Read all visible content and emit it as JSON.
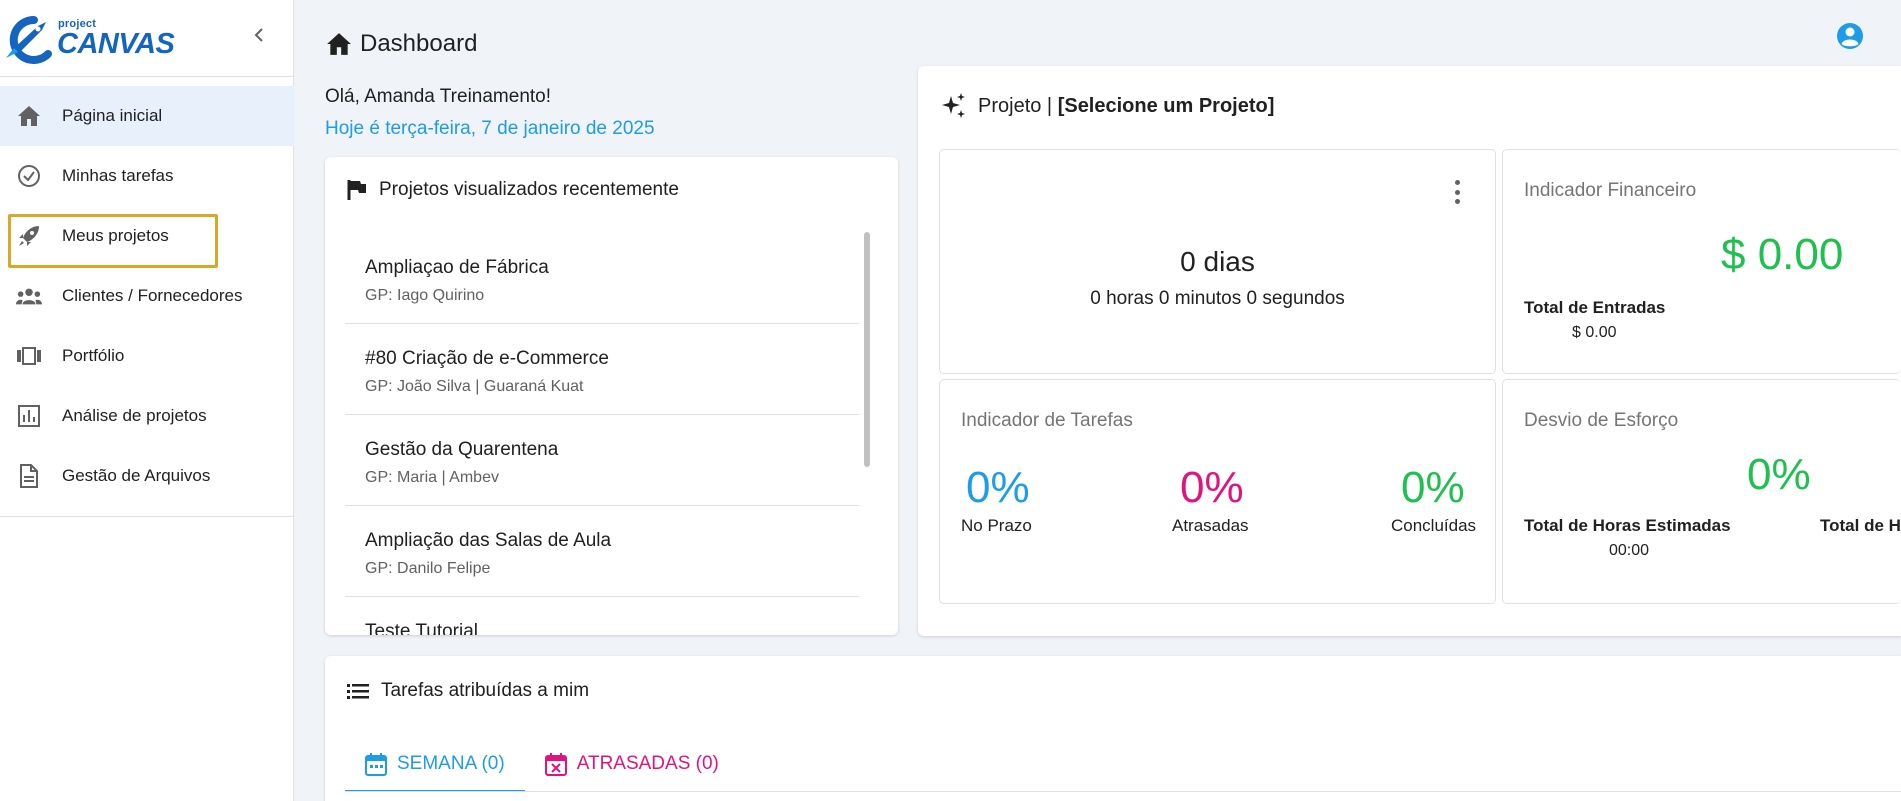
{
  "app": {
    "logo_small": "project",
    "logo_name": "CANVAS",
    "brand_color": "#1565c0",
    "accent_color": "#1e9be9"
  },
  "sidebar": {
    "items": [
      {
        "label": "Página inicial",
        "icon": "home-icon"
      },
      {
        "label": "Minhas tarefas",
        "icon": "check-circle-icon"
      },
      {
        "label": "Meus projetos",
        "icon": "rocket-icon"
      },
      {
        "label": "Clientes / Fornecedores",
        "icon": "people-icon"
      },
      {
        "label": "Portfólio",
        "icon": "portfolio-icon"
      },
      {
        "label": "Análise de projetos",
        "icon": "bar-chart-icon"
      },
      {
        "label": "Gestão de Arquivos",
        "icon": "file-icon"
      }
    ]
  },
  "header": {
    "title": "Dashboard"
  },
  "greeting": {
    "hello": "Olá, Amanda Treinamento!",
    "date": "Hoje é terça-feira, 7 de janeiro de 2025"
  },
  "recent": {
    "title": "Projetos visualizados recentemente",
    "items": [
      {
        "name": "Ampliaçao de Fábrica",
        "gp": "GP: Iago Quirino"
      },
      {
        "name": "#80 Criação de e-Commerce",
        "gp": "GP: João Silva | Guaraná Kuat"
      },
      {
        "name": "Gestão da Quarentena",
        "gp": "GP: Maria | Ambev"
      },
      {
        "name": "Ampliação das Salas de Aula",
        "gp": "GP: Danilo Felipe"
      },
      {
        "name": "Teste Tutorial",
        "gp": ""
      }
    ]
  },
  "project": {
    "prefix": "Projeto | ",
    "selected": "[Selecione um Projeto]",
    "timer": {
      "days": "0 dias",
      "hms": "0 horas 0 minutos 0 segundos"
    },
    "financial": {
      "title": "Indicador Financeiro",
      "value": "$ 0.00",
      "entries_label": "Total de Entradas",
      "entries_value": "$ 0.00"
    },
    "tasks": {
      "title": "Indicador de Tarefas",
      "on_time": "0%",
      "on_time_label": "No Prazo",
      "late": "0%",
      "late_label": "Atrasadas",
      "done": "0%",
      "done_label": "Concluídas",
      "colors": {
        "on_time": "#1e9be9",
        "late": "#e2137f",
        "done": "#1ec04e"
      }
    },
    "effort": {
      "title": "Desvio de Esforço",
      "value": "0%",
      "est_label": "Total de Horas Estimadas",
      "est_value": "00:00",
      "other_label": "Total de Horas Realizadas"
    }
  },
  "assigned": {
    "title": "Tarefas atribuídas a mim",
    "tab_week": "SEMANA (0)",
    "tab_late": "ATRASADAS (0)"
  }
}
